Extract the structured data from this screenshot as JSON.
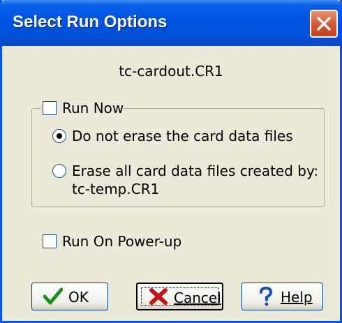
{
  "window": {
    "title": "Select Run Options"
  },
  "file": {
    "name": "tc-cardout.CR1"
  },
  "group": {
    "run_now": {
      "label": "Run Now",
      "checked": false
    },
    "options": [
      {
        "label": "Do not erase the card data files",
        "selected": true
      },
      {
        "label_line1": "Erase all card data files created by:",
        "label_line2": "tc-temp.CR1",
        "selected": false
      }
    ]
  },
  "run_on_powerup": {
    "label": "Run On Power-up",
    "checked": false
  },
  "buttons": {
    "ok": {
      "label": "OK",
      "icon": "checkmark-icon"
    },
    "cancel": {
      "label": "Cancel",
      "icon": "x-icon"
    },
    "help": {
      "label": "Help",
      "icon": "question-icon"
    }
  },
  "colors": {
    "title_bar": "#0054e3",
    "dialog_bg": "#ece9d8",
    "close_button": "#d3532f"
  }
}
